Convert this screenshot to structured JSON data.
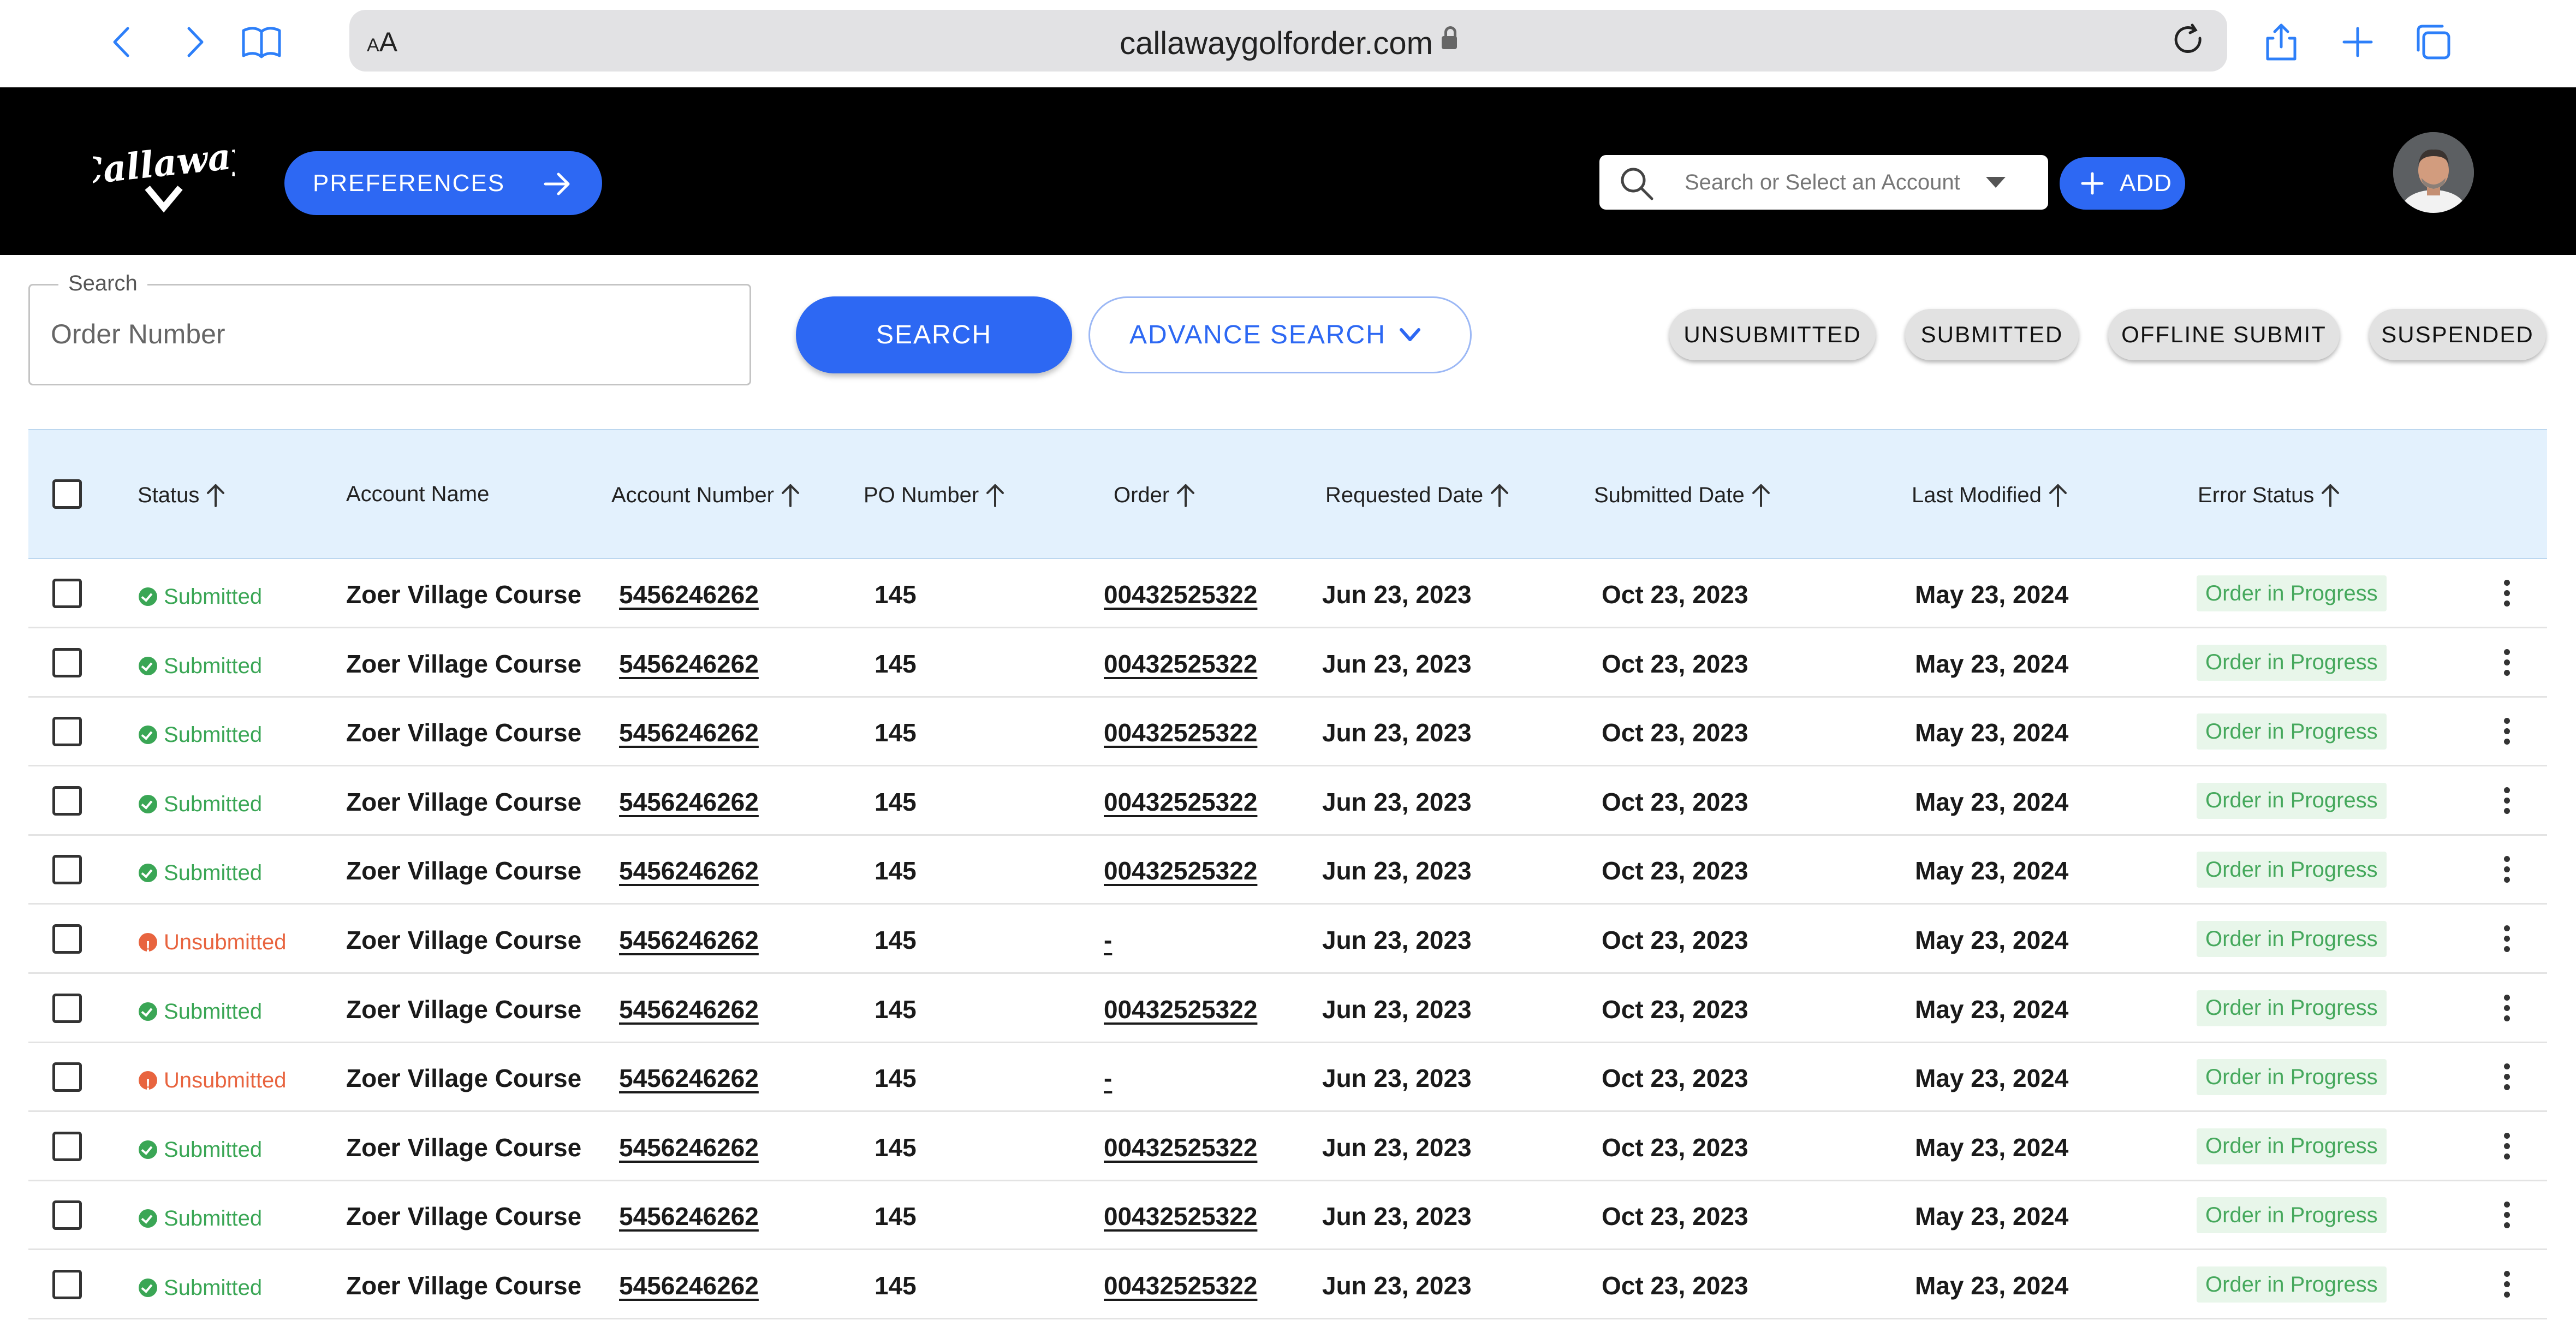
{
  "browser": {
    "text_size_label_small": "A",
    "text_size_label_large": "A",
    "url": "callawaygolforder.com"
  },
  "header": {
    "logo_text": "Callaway",
    "preferences_label": "PREFERENCES",
    "account_search_placeholder": "Search or Select an Account",
    "add_label": "ADD"
  },
  "search": {
    "legend": "Search",
    "placeholder": "Order Number",
    "search_button": "SEARCH",
    "advance_search_button": "ADVANCE SEARCH"
  },
  "filters": [
    "UNSUBMITTED",
    "SUBMITTED",
    "OFFLINE SUBMIT",
    "SUSPENDED"
  ],
  "table": {
    "columns": [
      "Status",
      "Account Name",
      "Account Number",
      "PO Number",
      "Order",
      "Requested Date",
      "Submitted Date",
      "Last Modified",
      "Error Status"
    ],
    "rows": [
      {
        "status": "Submitted",
        "account_name": "Zoer Village Course",
        "account_number": "5456246262",
        "po": "145",
        "order": "00432525322",
        "requested": "Jun 23, 2023",
        "submitted": "Oct 23, 2023",
        "modified": "May 23, 2024",
        "error": "Order in Progress"
      },
      {
        "status": "Submitted",
        "account_name": "Zoer Village Course",
        "account_number": "5456246262",
        "po": "145",
        "order": "00432525322",
        "requested": "Jun 23, 2023",
        "submitted": "Oct 23, 2023",
        "modified": "May 23, 2024",
        "error": "Order in Progress"
      },
      {
        "status": "Submitted",
        "account_name": "Zoer Village Course",
        "account_number": "5456246262",
        "po": "145",
        "order": "00432525322",
        "requested": "Jun 23, 2023",
        "submitted": "Oct 23, 2023",
        "modified": "May 23, 2024",
        "error": "Order in Progress"
      },
      {
        "status": "Submitted",
        "account_name": "Zoer Village Course",
        "account_number": "5456246262",
        "po": "145",
        "order": "00432525322",
        "requested": "Jun 23, 2023",
        "submitted": "Oct 23, 2023",
        "modified": "May 23, 2024",
        "error": "Order in Progress"
      },
      {
        "status": "Submitted",
        "account_name": "Zoer Village Course",
        "account_number": "5456246262",
        "po": "145",
        "order": "00432525322",
        "requested": "Jun 23, 2023",
        "submitted": "Oct 23, 2023",
        "modified": "May 23, 2024",
        "error": "Order in Progress"
      },
      {
        "status": "Unsubmitted",
        "account_name": "Zoer Village Course",
        "account_number": "5456246262",
        "po": "145",
        "order": "-",
        "requested": "Jun 23, 2023",
        "submitted": "Oct 23, 2023",
        "modified": "May 23, 2024",
        "error": "Order in Progress"
      },
      {
        "status": "Submitted",
        "account_name": "Zoer Village Course",
        "account_number": "5456246262",
        "po": "145",
        "order": "00432525322",
        "requested": "Jun 23, 2023",
        "submitted": "Oct 23, 2023",
        "modified": "May 23, 2024",
        "error": "Order in Progress"
      },
      {
        "status": "Unsubmitted",
        "account_name": "Zoer Village Course",
        "account_number": "5456246262",
        "po": "145",
        "order": "-",
        "requested": "Jun 23, 2023",
        "submitted": "Oct 23, 2023",
        "modified": "May 23, 2024",
        "error": "Order in Progress"
      },
      {
        "status": "Submitted",
        "account_name": "Zoer Village Course",
        "account_number": "5456246262",
        "po": "145",
        "order": "00432525322",
        "requested": "Jun 23, 2023",
        "submitted": "Oct 23, 2023",
        "modified": "May 23, 2024",
        "error": "Order in Progress"
      },
      {
        "status": "Submitted",
        "account_name": "Zoer Village Course",
        "account_number": "5456246262",
        "po": "145",
        "order": "00432525322",
        "requested": "Jun 23, 2023",
        "submitted": "Oct 23, 2023",
        "modified": "May 23, 2024",
        "error": "Order in Progress"
      },
      {
        "status": "Submitted",
        "account_name": "Zoer Village Course",
        "account_number": "5456246262",
        "po": "145",
        "order": "00432525322",
        "requested": "Jun 23, 2023",
        "submitted": "Oct 23, 2023",
        "modified": "May 23, 2024",
        "error": "Order in Progress"
      }
    ]
  },
  "colors": {
    "accent": "#2d68f3",
    "header_bg": "#000000",
    "table_header_bg": "#e3f1fd",
    "submitted": "#3aa655",
    "unsubmitted": "#e8643f"
  },
  "icons": [
    "back-icon",
    "forward-icon",
    "bookmarks-icon",
    "lock-icon",
    "reload-icon",
    "share-icon",
    "new-tab-icon",
    "tabs-icon",
    "arrow-right-icon",
    "search-icon",
    "dropdown-caret-icon",
    "plus-icon",
    "chevron-down-icon",
    "sort-up-icon",
    "kebab-menu-icon"
  ]
}
